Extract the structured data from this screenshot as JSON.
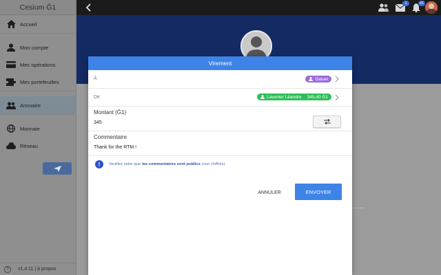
{
  "app": {
    "title": "Cesium Ğ1"
  },
  "sidebar": {
    "items": [
      {
        "label": "Accueil",
        "icon": "home-icon"
      },
      {
        "label": "Mon compte",
        "icon": "person-icon"
      },
      {
        "label": "Mes opérations",
        "icon": "card-icon"
      },
      {
        "label": "Mes portefeuilles",
        "icon": "wallets-icon"
      },
      {
        "label": "Annuaire",
        "icon": "people-icon",
        "active": true
      },
      {
        "label": "Monnaie",
        "icon": "globe-icon"
      },
      {
        "label": "Réseau",
        "icon": "cloud-icon"
      }
    ],
    "footer": {
      "version": "v1.4.11 | à propos"
    }
  },
  "topbar": {
    "badges": {
      "messages": "1",
      "notifications": "41"
    }
  },
  "modal": {
    "title": "Virement",
    "to": {
      "label": "À",
      "chip": "Galuel",
      "chip_color": "#9c6be0"
    },
    "from": {
      "label": "De",
      "name": "Lavenier Léandre",
      "balance": "345,40 Ğ1",
      "chip_color": "#2fbf5a"
    },
    "amount": {
      "label": "Montant (Ğ1)",
      "value": "345"
    },
    "comment": {
      "label": "Commentaire",
      "value": "Thank for the RTM !"
    },
    "notice": {
      "part1": "Veuillez noter que",
      "part2": "les commentaires sont publics",
      "part3": "(non chiffrés)."
    },
    "buttons": {
      "cancel": "ANNULER",
      "send": "ENVOYER"
    }
  },
  "colors": {
    "accent": "#3d83e8",
    "banner": "#142a63",
    "sidebar": "#8f8f8f",
    "topbar": "#1b1b1b"
  }
}
